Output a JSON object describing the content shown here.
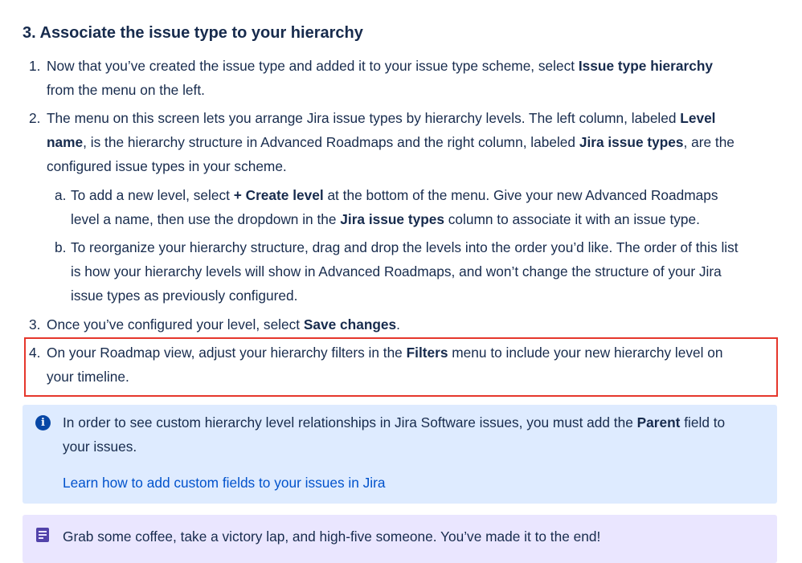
{
  "heading": "3. Associate the issue type to your hierarchy",
  "steps": [
    {
      "num": "1.",
      "t1": "Now that you’ve created the issue type and added it to your issue type scheme, select ",
      "b1": "Issue type hierarchy",
      "t2": "from the menu on the left."
    },
    {
      "num": "2.",
      "t1": "The menu on this screen lets you arrange Jira issue types by hierarchy levels. The left column, labeled ",
      "b1": "Level",
      "b1b": "name",
      "t2": ", is the hierarchy structure in Advanced Roadmaps and the right column, labeled ",
      "b2": "Jira issue types",
      "t3": ", are the",
      "t4": "configured issue types in your scheme.",
      "sub": [
        {
          "num": "a.",
          "t1": "To add a new level, select ",
          "b1": "+ Create level",
          "t2": " at the bottom of the menu. Give your new Advanced Roadmaps",
          "t3": "level a name, then use the dropdown in the ",
          "b2": "Jira issue types",
          "t4": " column to associate it with an issue type."
        },
        {
          "num": "b.",
          "l1": "To reorganize your hierarchy structure, drag and drop the levels into the order you’d like. The order of this list",
          "l2": "is how your hierarchy levels will show in Advanced Roadmaps, and won’t change the structure of your Jira",
          "l3": "issue types as previously configured."
        }
      ]
    },
    {
      "num": "3.",
      "t1": "Once you’ve configured your level, select ",
      "b1": "Save changes",
      "t2": "."
    },
    {
      "num": "4.",
      "t1": "On your Roadmap view, adjust your hierarchy filters in the ",
      "b1": "Filters",
      "t2": " menu to include your new hierarchy level on",
      "t3": "your timeline."
    }
  ],
  "info_panel": {
    "icon": "info-icon",
    "t1": "In order to see custom hierarchy level relationships in Jira Software issues, you must add the ",
    "b1": "Parent",
    "t2": " field to",
    "t3": "your issues.",
    "link": "Learn how to add custom fields to your issues in Jira"
  },
  "note_panel": {
    "icon": "note-icon",
    "text": "Grab some coffee, take a victory lap, and high-five someone. You’ve made it to the end!"
  },
  "colors": {
    "text": "#172b4d",
    "highlight_border": "#e5372c",
    "info_bg": "#deebff",
    "info_icon": "#0747a6",
    "link": "#0052cc",
    "note_bg": "#eae6ff",
    "note_icon": "#5243aa"
  }
}
